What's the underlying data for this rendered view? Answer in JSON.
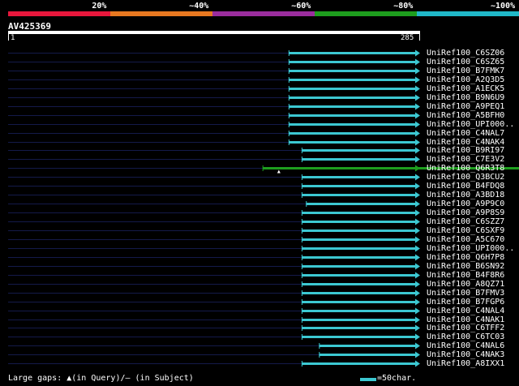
{
  "legend": {
    "labels": [
      "20%",
      "~40%",
      "~60%",
      "~80%",
      "~100%"
    ],
    "colors": [
      "#e8173c",
      "#e87820",
      "#9b2d9e",
      "#1e9e1e",
      "#20b8c8"
    ]
  },
  "query": {
    "id": "AV425369",
    "start": "1",
    "end": "285"
  },
  "colors": {
    "hit_main": "#3cc8d2",
    "hit_green": "#1e9e1e",
    "dark_line": "#141a4a"
  },
  "hits": [
    {
      "label": "UniRef100_C6SZ06",
      "start": 195,
      "color": "cyan"
    },
    {
      "label": "UniRef100_C6SZ65",
      "start": 195,
      "color": "cyan"
    },
    {
      "label": "UniRef100_B7FMK7",
      "start": 195,
      "color": "cyan"
    },
    {
      "label": "UniRef100_A2Q3D5",
      "start": 195,
      "color": "cyan"
    },
    {
      "label": "UniRef100_A1ECK5",
      "start": 195,
      "color": "cyan"
    },
    {
      "label": "UniRef100_B9N6U9",
      "start": 195,
      "color": "cyan"
    },
    {
      "label": "UniRef100_A9PEQ1",
      "start": 195,
      "color": "cyan"
    },
    {
      "label": "UniRef100_A5BFH0",
      "start": 195,
      "color": "cyan"
    },
    {
      "label": "UniRef100_UPI000..",
      "start": 195,
      "color": "cyan"
    },
    {
      "label": "UniRef100_C4NAL7",
      "start": 195,
      "color": "cyan"
    },
    {
      "label": "UniRef100_C4NAK4",
      "start": 195,
      "color": "cyan"
    },
    {
      "label": "UniRef100_B9RI97",
      "start": 204,
      "color": "cyan"
    },
    {
      "label": "UniRef100_C7E3V2",
      "start": 204,
      "color": "cyan"
    },
    {
      "label": "UniRef100_Q6R3T8",
      "start": 177,
      "color": "green",
      "gap": true
    },
    {
      "label": "UniRef100_Q3BCU2",
      "start": 204,
      "color": "cyan"
    },
    {
      "label": "UniRef100_B4FDQ8",
      "start": 204,
      "color": "cyan"
    },
    {
      "label": "UniRef100_A3BD18",
      "start": 204,
      "color": "cyan"
    },
    {
      "label": "UniRef100_A9P9C0",
      "start": 207,
      "color": "cyan"
    },
    {
      "label": "UniRef100_A9P8S9",
      "start": 204,
      "color": "cyan"
    },
    {
      "label": "UniRef100_C6SZZ7",
      "start": 204,
      "color": "cyan"
    },
    {
      "label": "UniRef100_C6SXF9",
      "start": 204,
      "color": "cyan"
    },
    {
      "label": "UniRef100_A5C670",
      "start": 204,
      "color": "cyan"
    },
    {
      "label": "UniRef100_UPI000..",
      "start": 204,
      "color": "cyan"
    },
    {
      "label": "UniRef100_Q6H7P8",
      "start": 204,
      "color": "cyan"
    },
    {
      "label": "UniRef100_B6SN92",
      "start": 204,
      "color": "cyan"
    },
    {
      "label": "UniRef100_B4F8R6",
      "start": 204,
      "color": "cyan"
    },
    {
      "label": "UniRef100_A8QZ71",
      "start": 204,
      "color": "cyan"
    },
    {
      "label": "UniRef100_B7FMV3",
      "start": 204,
      "color": "cyan"
    },
    {
      "label": "UniRef100_B7FGP6",
      "start": 204,
      "color": "cyan"
    },
    {
      "label": "UniRef100_C4NAL4",
      "start": 204,
      "color": "cyan"
    },
    {
      "label": "UniRef100_C4NAK1",
      "start": 204,
      "color": "cyan"
    },
    {
      "label": "UniRef100_C6TFF2",
      "start": 204,
      "color": "cyan"
    },
    {
      "label": "UniRef100_C6TC03",
      "start": 204,
      "color": "cyan"
    },
    {
      "label": "UniRef100_C4NAL6",
      "start": 216,
      "color": "cyan"
    },
    {
      "label": "UniRef100_C4NAK3",
      "start": 216,
      "color": "cyan"
    },
    {
      "label": "UniRef100_A8IXX1",
      "start": 204,
      "color": "cyan"
    }
  ],
  "footer": {
    "gaps_text": "Large gaps: ▲(in Query)/— (in Subject)",
    "scale_text": "=50char."
  }
}
